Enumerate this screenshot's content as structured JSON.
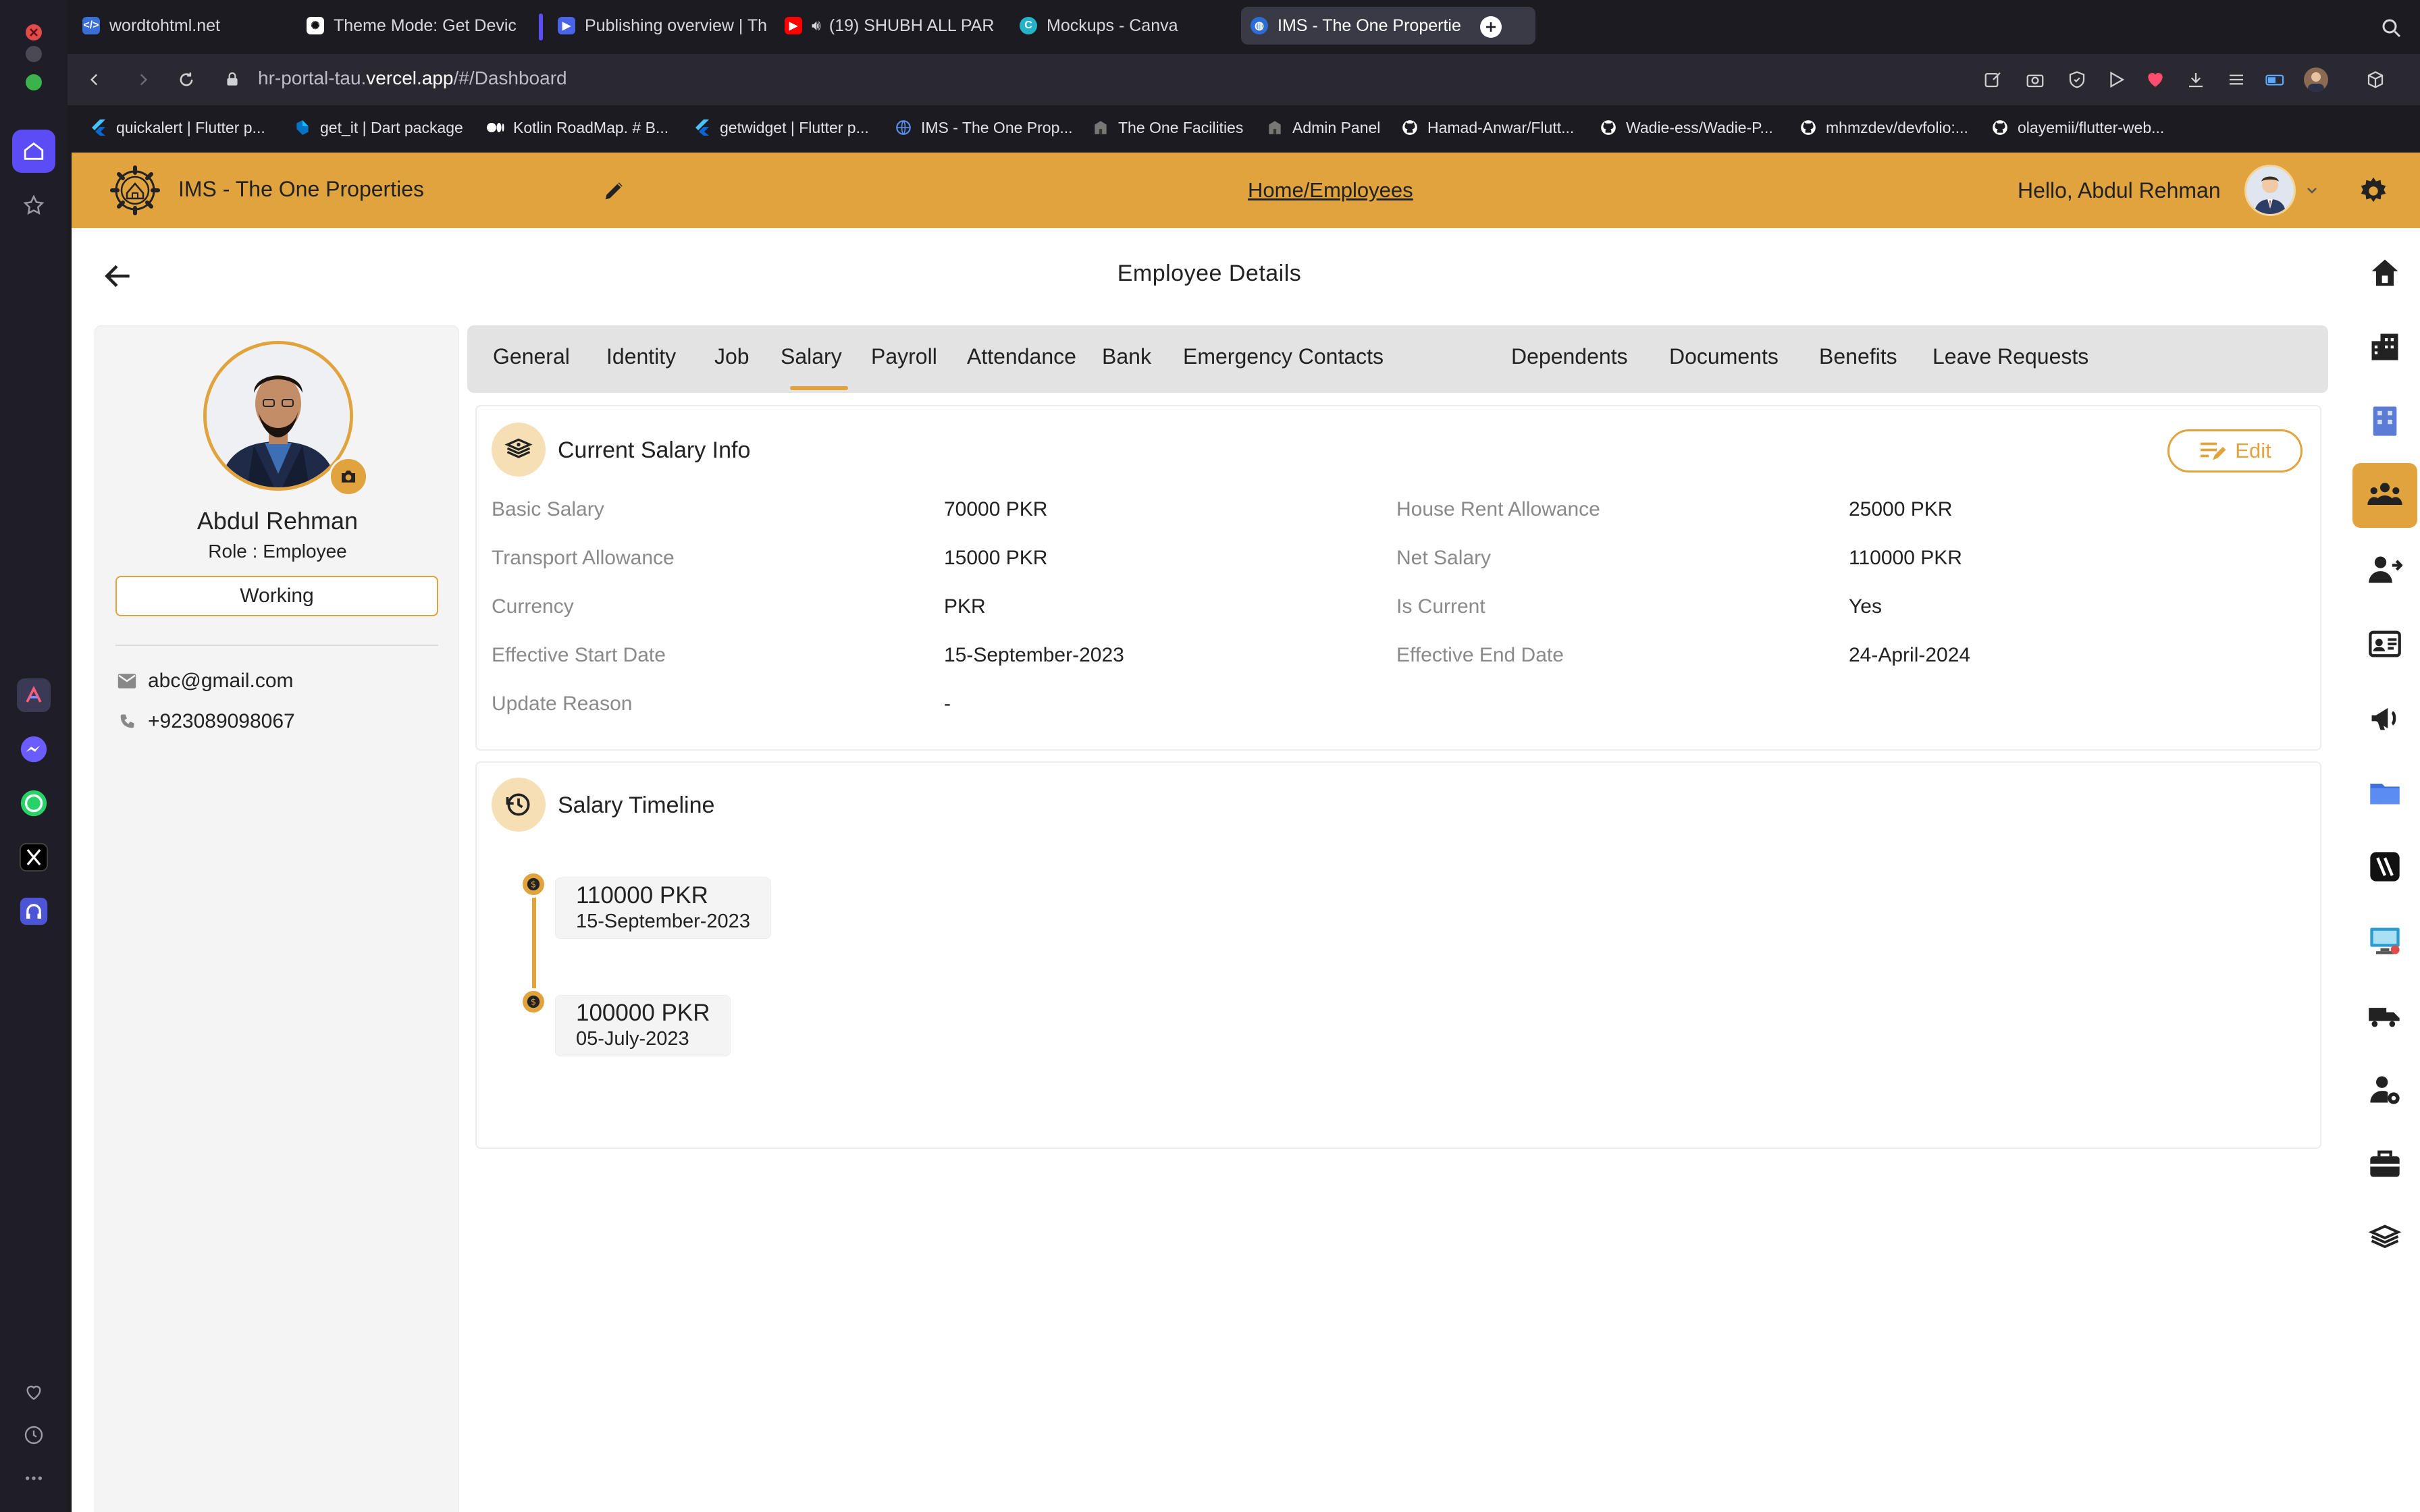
{
  "browser": {
    "tabs": [
      {
        "title": "wordtohtml.net",
        "icon": "code-icon"
      },
      {
        "title": "Theme Mode: Get Devic",
        "icon": "openai-icon"
      },
      {
        "title": "Publishing overview | Th",
        "icon": "play-console-icon"
      },
      {
        "title": "(19) SHUBH ALL PAR",
        "icon": "youtube-icon"
      },
      {
        "title": "Mockups - Canva",
        "icon": "canva-icon"
      },
      {
        "title": "IMS - The One Propertie",
        "icon": "globe-icon",
        "active": true
      }
    ],
    "url": {
      "prefix": "hr-portal-tau.",
      "domain": "vercel.app",
      "path": "/#/Dashboard"
    },
    "bookmarks": [
      {
        "label": "quickalert | Flutter p...",
        "icon": "flutter-icon"
      },
      {
        "label": "get_it | Dart package",
        "icon": "dart-icon"
      },
      {
        "label": "Kotlin RoadMap. # B...",
        "icon": "medium-icon"
      },
      {
        "label": "getwidget | Flutter p...",
        "icon": "flutter-icon"
      },
      {
        "label": "IMS - The One Prop...",
        "icon": "globe-icon"
      },
      {
        "label": "The One Facilities",
        "icon": "building-icon"
      },
      {
        "label": "Admin Panel",
        "icon": "building-icon"
      },
      {
        "label": "Hamad-Anwar/Flutt...",
        "icon": "github-icon"
      },
      {
        "label": "Wadie-ess/Wadie-P...",
        "icon": "github-icon"
      },
      {
        "label": "mhmzdev/devfolio:...",
        "icon": "github-icon"
      },
      {
        "label": "olayemii/flutter-web...",
        "icon": "github-icon"
      }
    ]
  },
  "header": {
    "app_title": "IMS - The One Properties",
    "breadcrumb": "Home/Employees",
    "greeting": "Hello, Abdul Rehman"
  },
  "page": {
    "title": "Employee Details"
  },
  "profile": {
    "name": "Abdul Rehman",
    "role": "Role : Employee",
    "status": "Working",
    "email": "abc@gmail.com",
    "phone": "+923089098067"
  },
  "tabs": [
    "General",
    "Identity",
    "Job",
    "Salary",
    "Payroll",
    "Attendance",
    "Bank",
    "Emergency Contacts",
    "Dependents",
    "Documents",
    "Benefits",
    "Leave Requests"
  ],
  "selected_tab": "Salary",
  "salary_info": {
    "title": "Current Salary Info",
    "edit_label": "Edit",
    "fields": [
      {
        "label": "Basic Salary",
        "value": "70000 PKR"
      },
      {
        "label": "House Rent Allowance",
        "value": "25000 PKR"
      },
      {
        "label": "Transport Allowance",
        "value": "15000 PKR"
      },
      {
        "label": "Net Salary",
        "value": "110000 PKR"
      },
      {
        "label": "Currency",
        "value": "PKR"
      },
      {
        "label": "Is Current",
        "value": "Yes"
      },
      {
        "label": "Effective Start Date",
        "value": "15-September-2023"
      },
      {
        "label": "Effective End Date",
        "value": "24-April-2024"
      },
      {
        "label": "Update Reason",
        "value": "-"
      }
    ]
  },
  "salary_timeline": {
    "title": "Salary Timeline",
    "entries": [
      {
        "amount": "110000 PKR",
        "date": "15-September-2023"
      },
      {
        "amount": "100000 PKR",
        "date": "05-July-2023"
      }
    ]
  },
  "colors": {
    "accent": "#e0a33e",
    "accent_light": "#f6dfb5",
    "browser_bg": "#1c1b22",
    "browser_active": "#5b4cf5"
  }
}
